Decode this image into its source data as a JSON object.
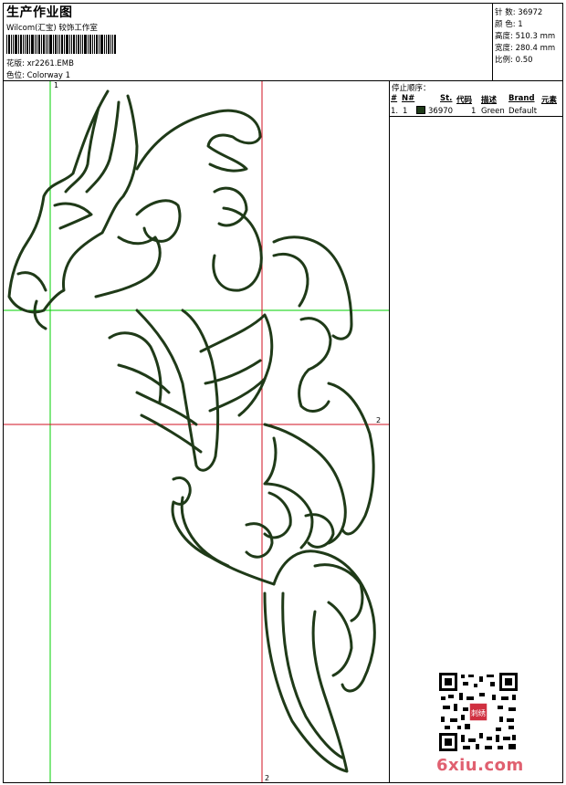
{
  "header": {
    "title": "生产作业图",
    "company": "Wilcom(汇宝) 较饰工作室",
    "design_label": "花版:",
    "design_file": "xr2261.EMB",
    "colorway_label": "色位:",
    "colorway": "Colorway 1"
  },
  "specs": [
    {
      "label": "针 数:",
      "value": "36972"
    },
    {
      "label": "颜 色:",
      "value": "1"
    },
    {
      "label": "高度:",
      "value": "510.3 mm"
    },
    {
      "label": "宽度:",
      "value": "280.4 mm"
    },
    {
      "label": "比例:",
      "value": "0.50"
    }
  ],
  "stop_sequence": {
    "title": "停止顺序：",
    "columns": [
      "#",
      "N#",
      "St.",
      "代码",
      "描述",
      "Brand",
      "元素"
    ],
    "rows": [
      {
        "index": "1.",
        "number": "1",
        "stitches": "36970",
        "code": "1",
        "description": "Green",
        "brand": "Default",
        "color": "#1f3a18"
      }
    ]
  },
  "axes": {
    "green_label": "1",
    "red_right_label": "2",
    "red_bottom_label": "2"
  },
  "colors": {
    "thread": "#1f3a18",
    "green_line": "#00d000",
    "red_line": "#d01020"
  },
  "watermark": {
    "text": "6xiu.com",
    "stamp_text": "刺绣"
  }
}
